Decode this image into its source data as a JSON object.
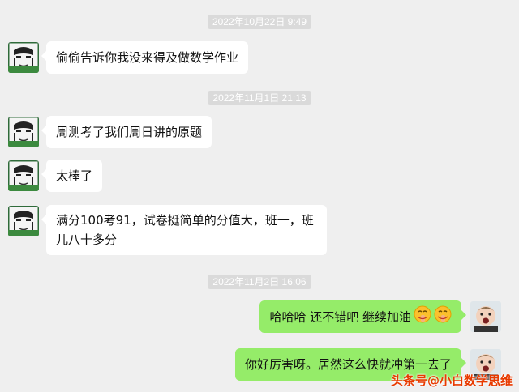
{
  "timestamps": [
    "2022年10月22日 9:49",
    "2022年11月1日 21:13",
    "2022年11月2日 16:06"
  ],
  "messages": [
    {
      "side": "in",
      "text": "偷偷告诉你我没来得及做数学作业"
    },
    {
      "side": "in",
      "text": "周测考了我们周日讲的原题"
    },
    {
      "side": "in",
      "text": "太棒了"
    },
    {
      "side": "in",
      "lines": [
        "满分100考91，试卷挺简单的分值大，班一，班",
        "儿八十多分"
      ]
    },
    {
      "side": "out",
      "text": "哈哈哈 还不错吧 继续加油",
      "emoji": [
        "shush-face-emoji",
        "shush-face-emoji"
      ]
    },
    {
      "side": "out",
      "text": "你好厉害呀。居然这么快就冲第一去了"
    }
  ],
  "watermark": "头条号@小白数学思维",
  "colors": {
    "background": "#efefef",
    "incoming": "#ffffff",
    "outgoing": "#95ec69",
    "timestamp": "#dadada",
    "watermark": "#e83a00"
  }
}
